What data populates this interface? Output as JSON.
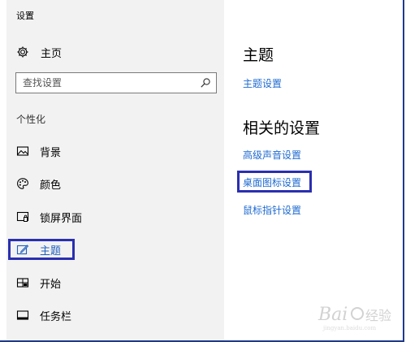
{
  "window": {
    "title": "设置"
  },
  "sidebar": {
    "home_label": "主页",
    "search_placeholder": "查找设置",
    "section_label": "个性化",
    "items": [
      {
        "label": "背景",
        "icon": "picture-icon"
      },
      {
        "label": "颜色",
        "icon": "palette-icon"
      },
      {
        "label": "锁屏界面",
        "icon": "lock-screen-icon"
      },
      {
        "label": "主题",
        "icon": "theme-brush-icon",
        "active": true
      },
      {
        "label": "开始",
        "icon": "start-tiles-icon"
      },
      {
        "label": "任务栏",
        "icon": "taskbar-icon"
      }
    ]
  },
  "main": {
    "title": "主题",
    "theme_settings_link": "主题设置",
    "related_title": "相关的设置",
    "related_links": [
      "高级声音设置",
      "桌面图标设置",
      "鼠标指针设置"
    ]
  },
  "colors": {
    "accent_link": "#1e6ad1",
    "highlight_box": "#2a2fb0",
    "sidebar_bg": "#f2f2f2"
  },
  "watermark": {
    "text": "Bai经验"
  }
}
